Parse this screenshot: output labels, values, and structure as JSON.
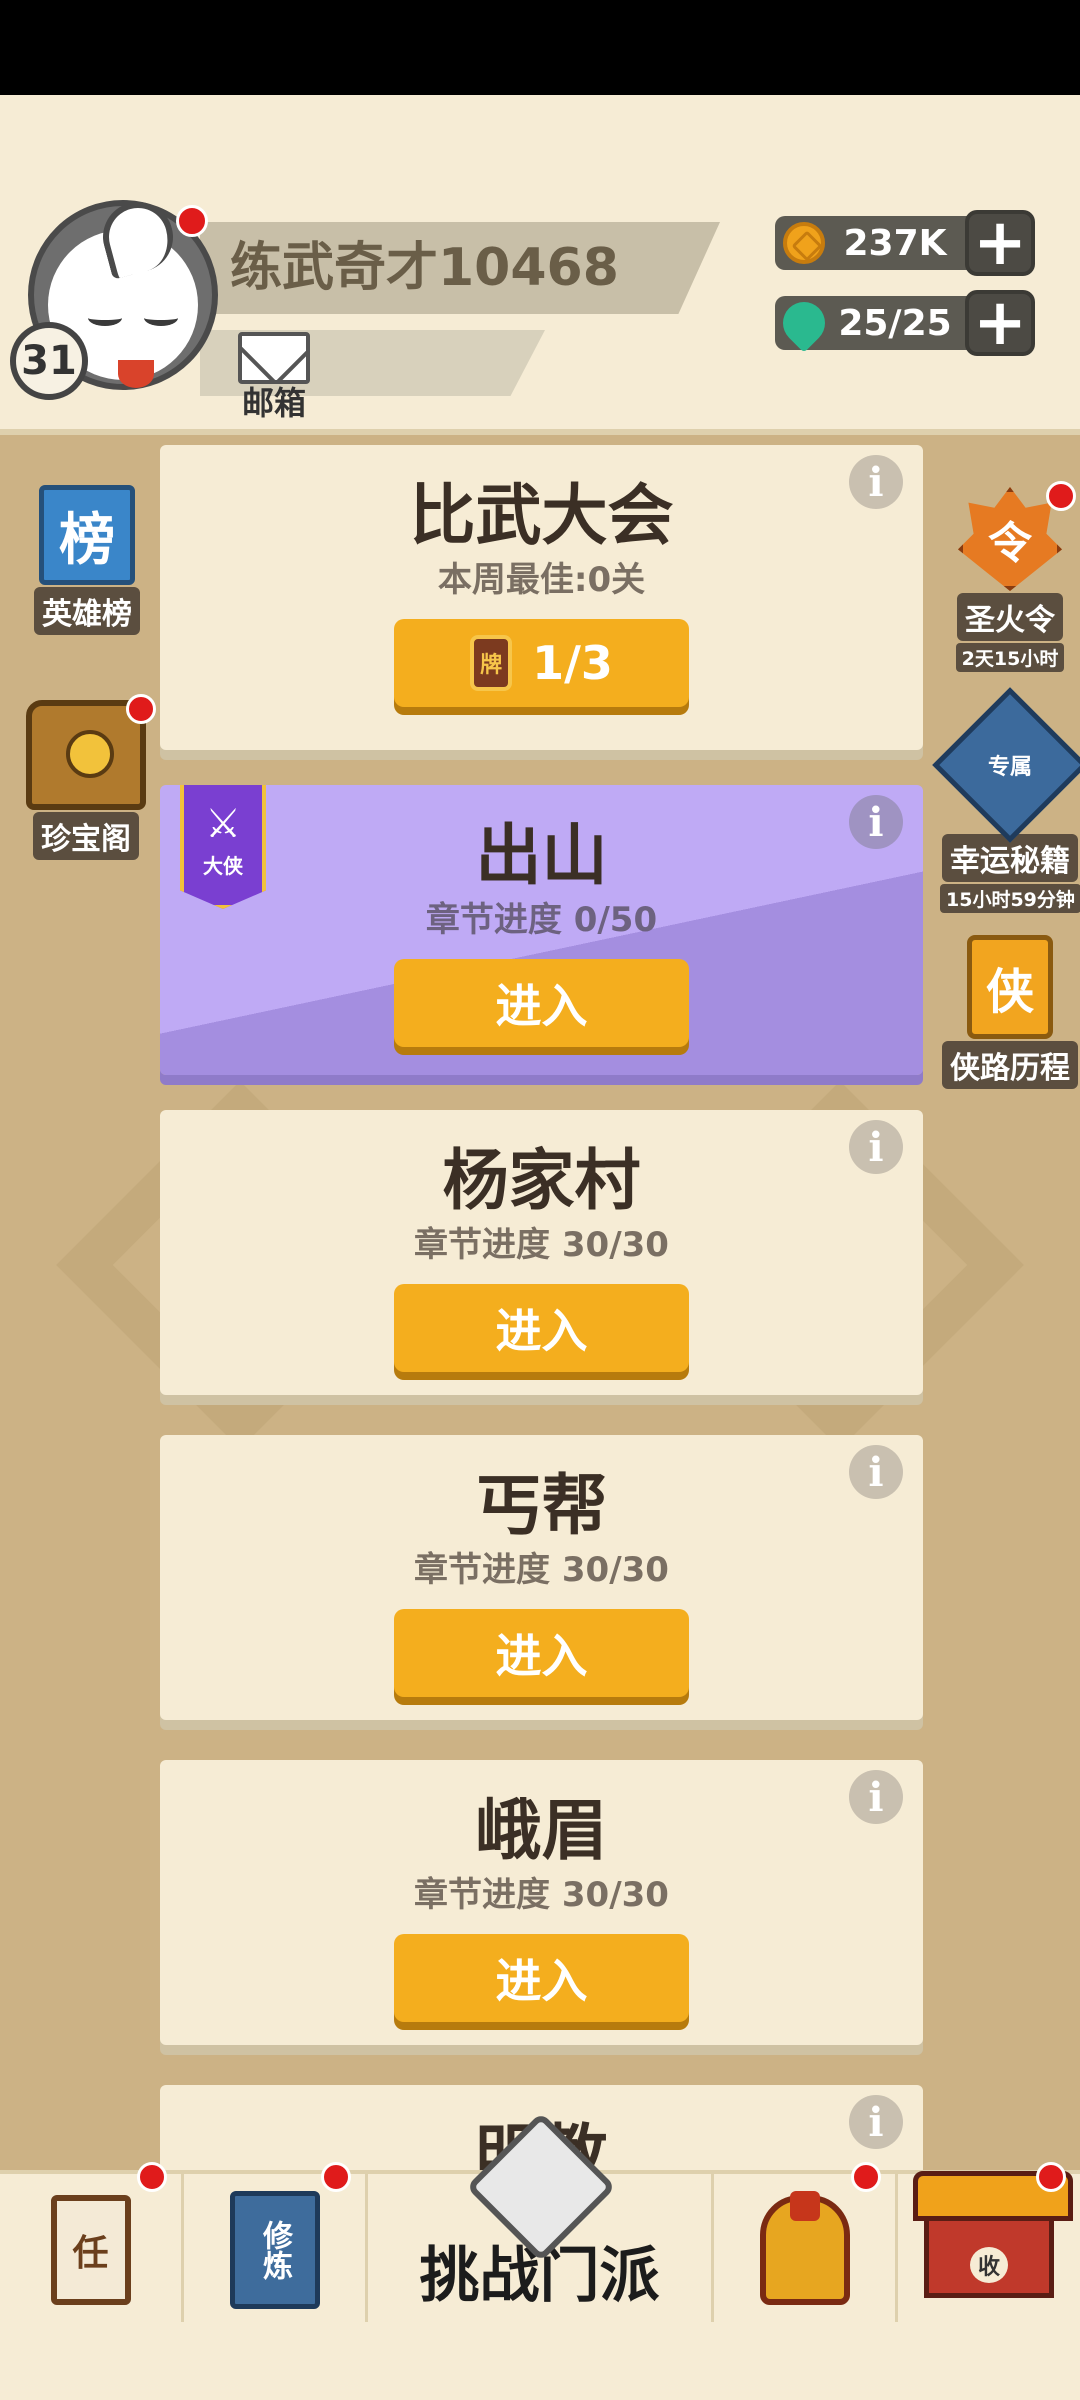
{
  "player": {
    "name": "练武奇才10468",
    "level": "31",
    "mail_label": "邮箱"
  },
  "resources": {
    "coins": "237K",
    "stamina": "25/25",
    "coin_icon": "coin-icon",
    "gem_icon": "gem-icon"
  },
  "left_menu": [
    {
      "label": "英雄榜",
      "icon_text": "榜",
      "icon": "rank-banner-icon"
    },
    {
      "label": "珍宝阁",
      "icon": "treasure-chest-icon"
    }
  ],
  "right_menu": [
    {
      "label": "圣火令",
      "sub": "2天15小时",
      "icon_text": "令",
      "icon": "sacred-fire-icon"
    },
    {
      "label": "幸运秘籍",
      "sub": "15小时59分钟",
      "icon_text": "专属",
      "icon": "secret-book-icon"
    },
    {
      "label": "侠路历程",
      "icon_text": "侠",
      "icon": "journey-icon"
    }
  ],
  "cards": [
    {
      "title": "比武大会",
      "sub": "本周最佳:0关",
      "button": "1/3",
      "ticket_text": "牌"
    },
    {
      "title": "出山",
      "sub": "章节进度 0/50",
      "button": "进入",
      "badge": "大侠"
    },
    {
      "title": "杨家村",
      "sub": "章节进度 30/30",
      "button": "进入"
    },
    {
      "title": "丐帮",
      "sub": "章节进度 30/30",
      "button": "进入"
    },
    {
      "title": "峨眉",
      "sub": "章节进度 30/30",
      "button": "进入"
    },
    {
      "title": "明教",
      "sub": "",
      "button": ""
    }
  ],
  "info_glyph": "i",
  "bottom_nav": {
    "task_icon_text": "任",
    "train_icon_text": "修炼",
    "center_label": "挑战门派",
    "collect_icon_text": "收"
  },
  "colors": {
    "accent_button": "#f4ae1e",
    "card_bg": "#f6ecd5",
    "purple_card": "#bfaaf5",
    "notification": "#e01b1b"
  }
}
